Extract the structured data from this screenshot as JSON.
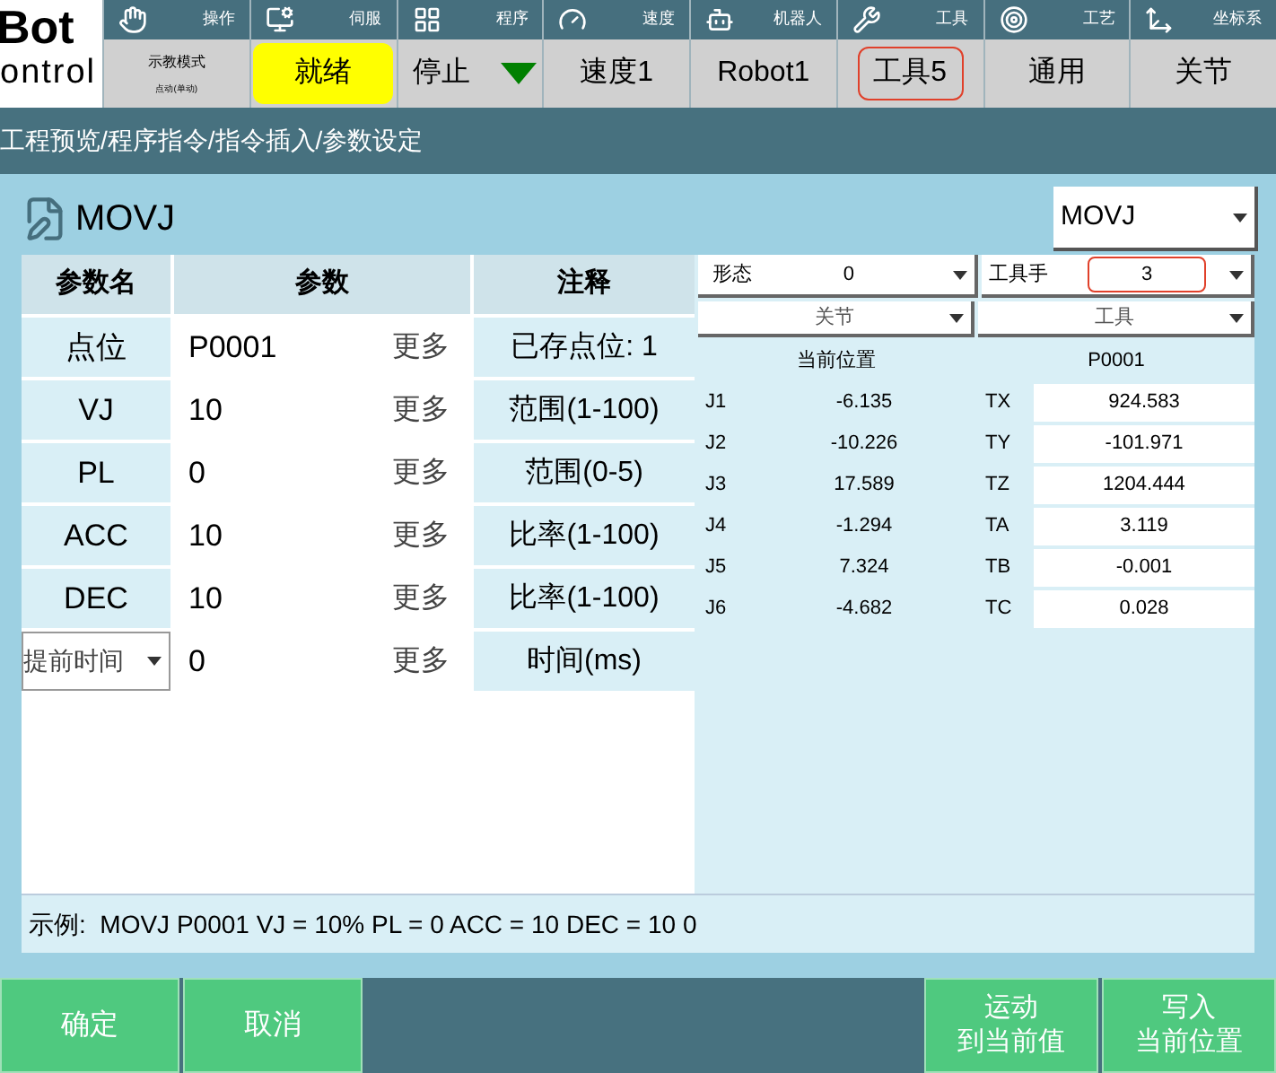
{
  "logo": {
    "line1": "Bot",
    "line2": "ontrol"
  },
  "header_tabs": [
    {
      "label": "操作",
      "value": "示教模式",
      "subvalue": "点动(单动)",
      "kind": "two_line",
      "highlighted": false
    },
    {
      "label": "伺服",
      "value": "就绪",
      "kind": "ready",
      "highlighted": false
    },
    {
      "label": "程序",
      "value": "停止",
      "kind": "stop",
      "highlighted": false
    },
    {
      "label": "速度",
      "value": "速度1",
      "kind": "plain",
      "highlighted": false
    },
    {
      "label": "机器人",
      "value": "Robot1",
      "kind": "plain",
      "highlighted": false
    },
    {
      "label": "工具",
      "value": "工具5",
      "kind": "plain",
      "highlighted": true
    },
    {
      "label": "工艺",
      "value": "通用",
      "kind": "plain",
      "highlighted": false
    },
    {
      "label": "坐标系",
      "value": "关节",
      "kind": "plain",
      "highlighted": false
    }
  ],
  "breadcrumb": "工程预览/程序指令/指令插入/参数设定",
  "title": "MOVJ",
  "command_select": "MOVJ",
  "param_table": {
    "columns": [
      "参数名",
      "参数",
      "注释"
    ],
    "rows": [
      {
        "name": "点位",
        "value": "P0001",
        "more": "更多",
        "note": "已存点位: 1",
        "kind": "label"
      },
      {
        "name": "VJ",
        "value": "10",
        "more": "更多",
        "note": "范围(1-100)",
        "kind": "label"
      },
      {
        "name": "PL",
        "value": "0",
        "more": "更多",
        "note": "范围(0-5)",
        "kind": "label"
      },
      {
        "name": "ACC",
        "value": "10",
        "more": "更多",
        "note": "比率(1-100)",
        "kind": "label"
      },
      {
        "name": "DEC",
        "value": "10",
        "more": "更多",
        "note": "比率(1-100)",
        "kind": "label"
      },
      {
        "name": "提前时间",
        "value": "0",
        "more": "更多",
        "note": "时间(ms)",
        "kind": "select"
      }
    ]
  },
  "pose": {
    "form_label": "形态",
    "form_value": "0",
    "tool_label": "工具手",
    "tool_value": "3",
    "tool_highlighted": true,
    "left_select": "关节",
    "right_select": "工具",
    "left_header": "当前位置",
    "right_header": "P0001",
    "joints": [
      {
        "name": "J1",
        "value": "-6.135"
      },
      {
        "name": "J2",
        "value": "-10.226"
      },
      {
        "name": "J3",
        "value": "17.589"
      },
      {
        "name": "J4",
        "value": "-1.294"
      },
      {
        "name": "J5",
        "value": "7.324"
      },
      {
        "name": "J6",
        "value": "-4.682"
      }
    ],
    "tool": [
      {
        "name": "TX",
        "value": "924.583"
      },
      {
        "name": "TY",
        "value": "-101.971"
      },
      {
        "name": "TZ",
        "value": "1204.444"
      },
      {
        "name": "TA",
        "value": "3.119"
      },
      {
        "name": "TB",
        "value": "-0.001"
      },
      {
        "name": "TC",
        "value": "0.028"
      }
    ]
  },
  "example": "示例:  MOVJ P0001 VJ = 10% PL = 0 ACC = 10 DEC = 10 0",
  "footer_left": [
    "确定",
    "取消"
  ],
  "footer_right": [
    [
      "运动",
      "到当前值"
    ],
    [
      "写入",
      "当前位置"
    ]
  ]
}
